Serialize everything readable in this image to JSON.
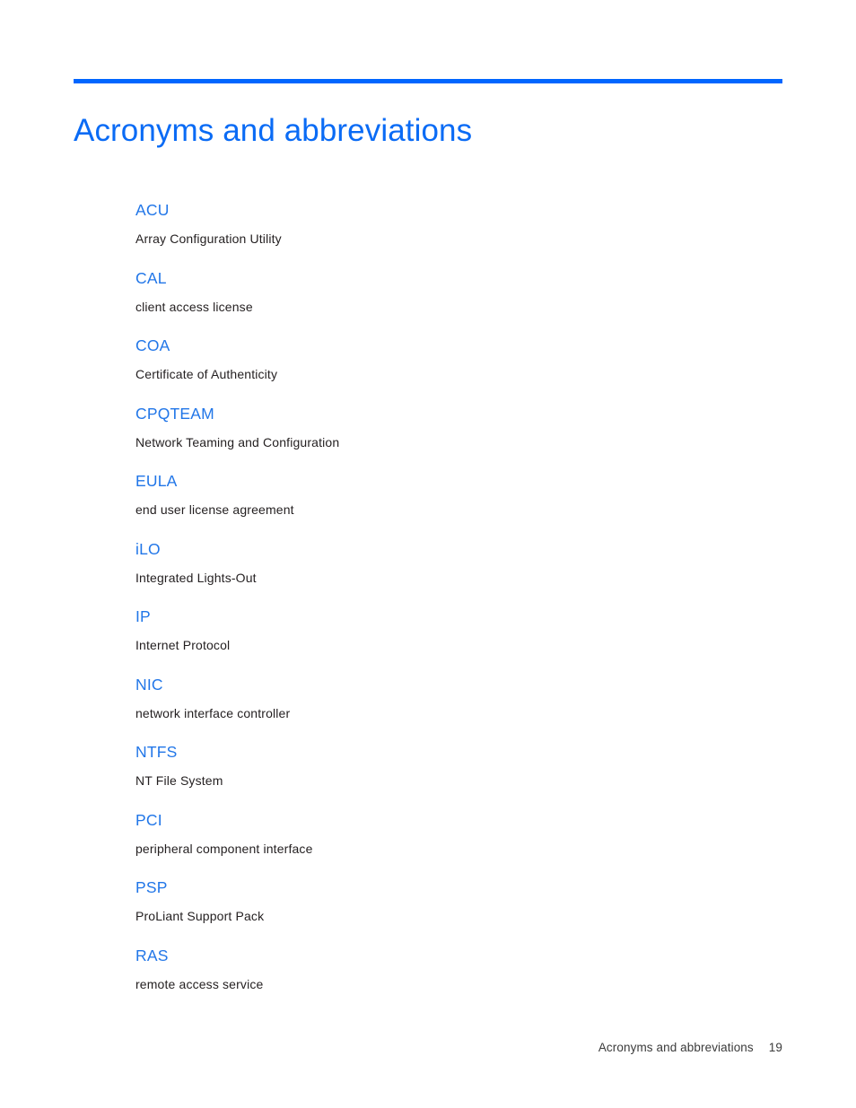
{
  "document": {
    "background_color": "#ffffff",
    "heading_color": "#0a6bf5",
    "rule_color": "#0066ff",
    "term_color": "#2176e8",
    "definition_color": "#231f20"
  },
  "header": {
    "title": "Acronyms and abbreviations"
  },
  "glossary": {
    "entries": [
      {
        "term": "ACU",
        "definition": "Array Configuration Utility"
      },
      {
        "term": "CAL",
        "definition": "client access license"
      },
      {
        "term": "COA",
        "definition": "Certificate of Authenticity"
      },
      {
        "term": "CPQTEAM",
        "definition": "Network Teaming and Configuration"
      },
      {
        "term": "EULA",
        "definition": "end user license agreement"
      },
      {
        "term": "iLO",
        "definition": "Integrated Lights-Out"
      },
      {
        "term": "IP",
        "definition": "Internet Protocol"
      },
      {
        "term": "NIC",
        "definition": "network interface controller"
      },
      {
        "term": "NTFS",
        "definition": "NT File System"
      },
      {
        "term": "PCI",
        "definition": "peripheral component interface"
      },
      {
        "term": "PSP",
        "definition": "ProLiant Support Pack"
      },
      {
        "term": "RAS",
        "definition": "remote access service"
      }
    ]
  },
  "footer": {
    "label": "Acronyms and abbreviations",
    "page_number": "19"
  }
}
